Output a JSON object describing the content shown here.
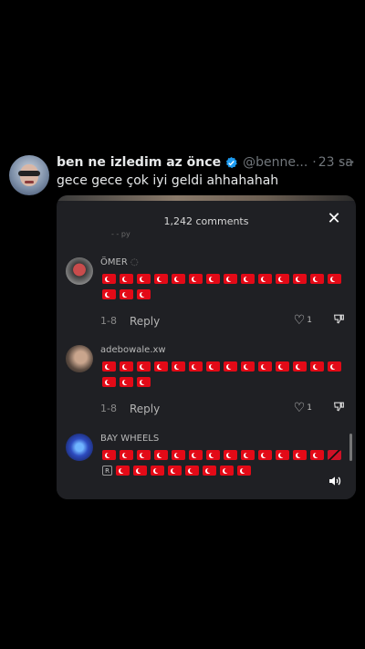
{
  "tweet": {
    "display_name": "ben ne izledim az önce",
    "handle": "@benne...",
    "separator": "·",
    "time": "23 sa",
    "more_label": "···",
    "text": "gece gece çok iyi geldi ahhahahah"
  },
  "video": {
    "sheet_title": "1,242 comments",
    "close_label": "✕",
    "prev_reply_fragment": "- - py",
    "comments": [
      {
        "username": "ÖMER",
        "username_suffix": "◌",
        "age": "1-8",
        "reply_label": "Reply",
        "likes": "1",
        "flag_count": 17
      },
      {
        "username": "adebowale.xw",
        "age": "1-8",
        "reply_label": "Reply",
        "likes": "1",
        "flag_count": 17
      },
      {
        "username": "BAY WHEELS",
        "extra_badge": "R",
        "flag_count": 21,
        "last_row_flags": 8
      }
    ]
  },
  "colors": {
    "background": "#000000",
    "sheet": "#1f2024",
    "flag_red": "#e30a17",
    "verified_blue": "#1d9bf0",
    "muted_text": "#71767b"
  }
}
